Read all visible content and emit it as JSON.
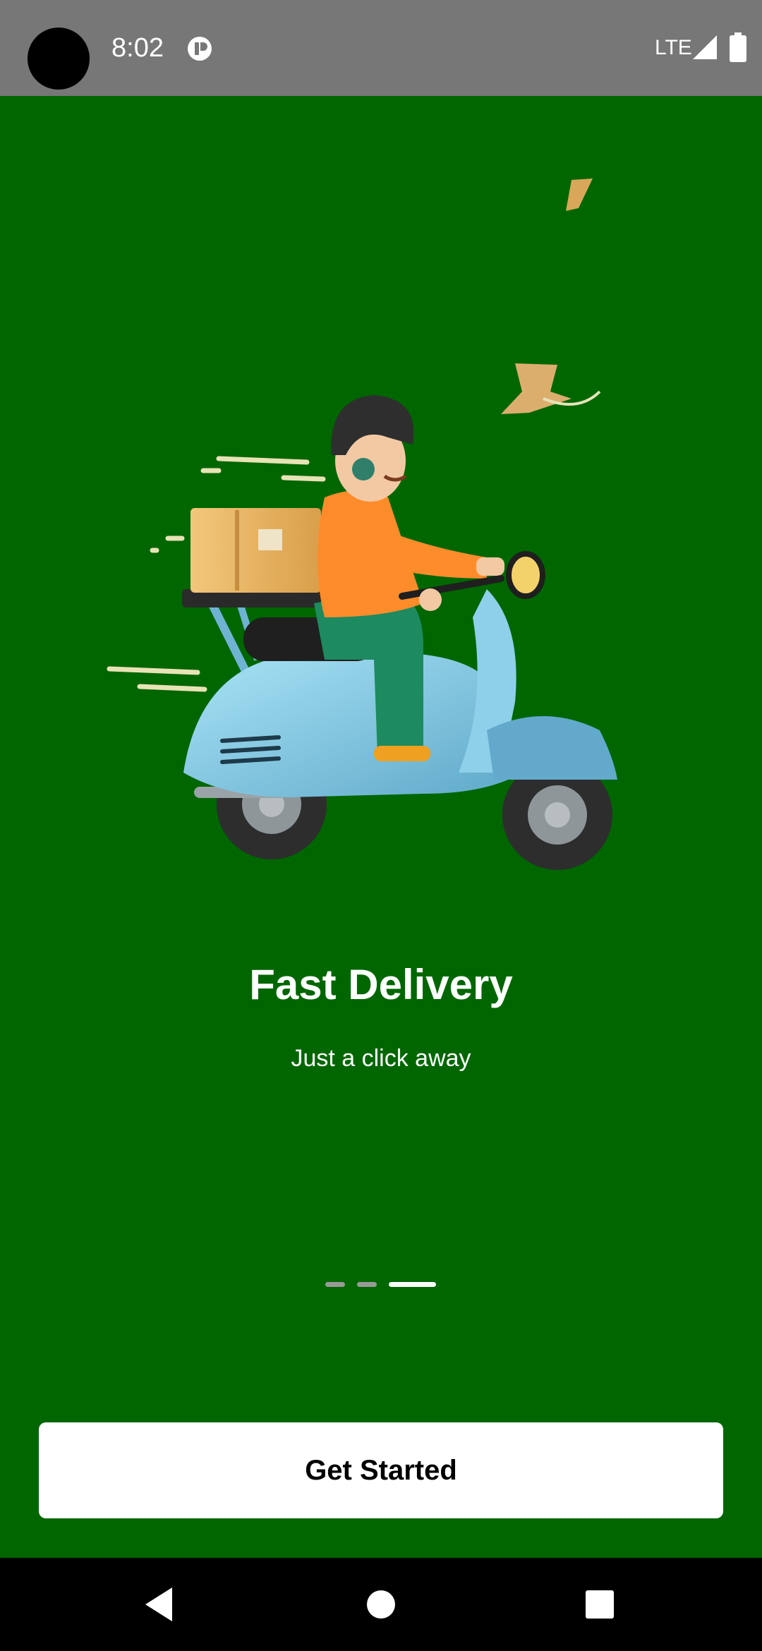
{
  "status_bar": {
    "time": "8:02",
    "network": "LTE",
    "icons": [
      "notification-icon",
      "signal-icon",
      "battery-icon"
    ]
  },
  "onboarding": {
    "title": "Fast Delivery",
    "subtitle": "Just a click away",
    "page_indicator": {
      "total": 3,
      "active": 3
    },
    "cta_label": "Get Started"
  },
  "nav_bar": {
    "buttons": [
      "back-icon",
      "home-icon",
      "recents-icon"
    ]
  },
  "colors": {
    "background": "#006600",
    "status_bar": "#777777",
    "button_bg": "#ffffff",
    "button_text": "#000000",
    "indicator_active": "#ffffff",
    "indicator_inactive": "#9a9a9a"
  }
}
